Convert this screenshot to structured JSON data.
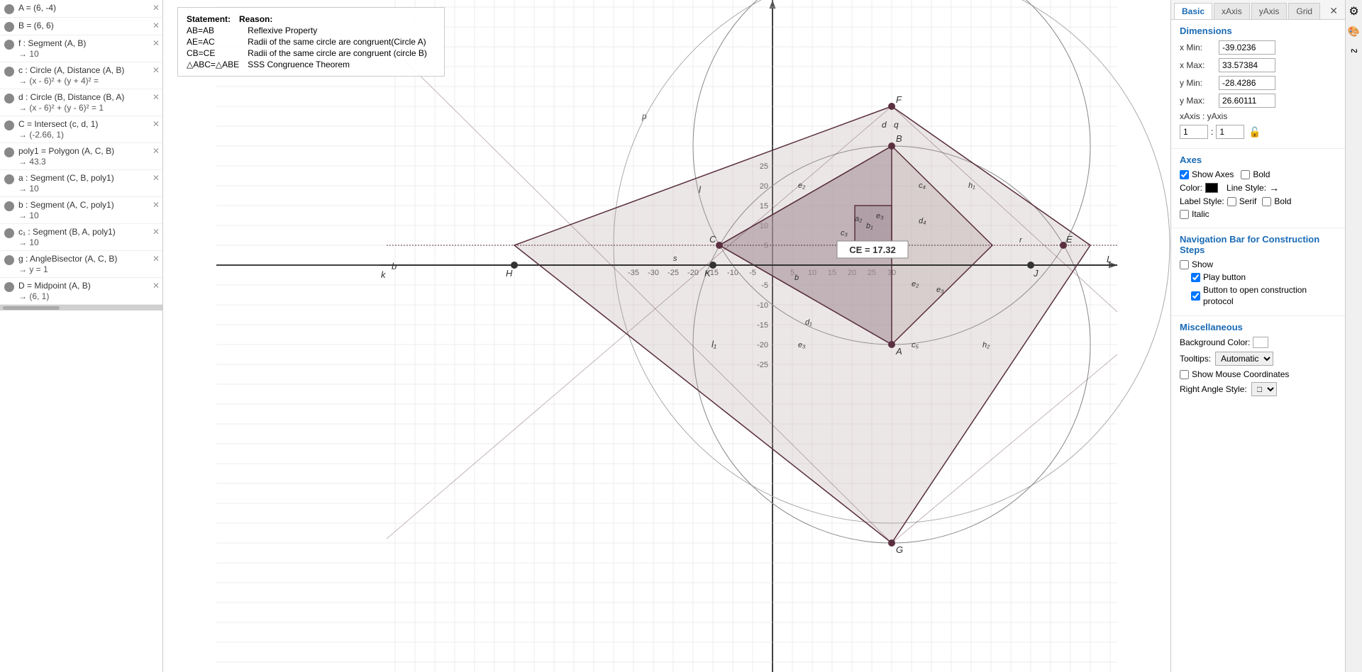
{
  "sidebar": {
    "items": [
      {
        "id": "A",
        "label": "A = (6, -4)",
        "value": null,
        "hasClose": true
      },
      {
        "id": "B",
        "label": "B = (6, 6)",
        "value": null,
        "hasClose": true
      },
      {
        "id": "f",
        "label": "f : Segment (A, B)",
        "value": "→ 10",
        "hasClose": true
      },
      {
        "id": "c",
        "label": "c : Circle (A, Distance (A, B)",
        "value": "→ (x - 6)² + (y + 4)² =",
        "hasClose": true
      },
      {
        "id": "d",
        "label": "d : Circle (B, Distance (B, A)",
        "value": "→ (x - 6)² + (y - 6)² = 1",
        "hasClose": true
      },
      {
        "id": "C",
        "label": "C = Intersect (c, d, 1)",
        "value": "→ (-2.66, 1)",
        "hasClose": true
      },
      {
        "id": "poly1",
        "label": "poly1 = Polygon (A, C, B)",
        "value": "→ 43.3",
        "hasClose": true
      },
      {
        "id": "a",
        "label": "a : Segment (C, B, poly1)",
        "value": "→ 10",
        "hasClose": true
      },
      {
        "id": "b_seg",
        "label": "b : Segment (A, C, poly1)",
        "value": "→ 10",
        "hasClose": true
      },
      {
        "id": "c1",
        "label": "c₁ : Segment (B, A, poly1)",
        "value": "→ 10",
        "hasClose": true
      },
      {
        "id": "g",
        "label": "g : AngleBisector (A, C, B)",
        "value": "→ y = 1",
        "hasClose": true
      },
      {
        "id": "D",
        "label": "D = Midpoint (A, B)",
        "value": "→ (6, 1)",
        "hasClose": true
      }
    ]
  },
  "proof": {
    "statement_header": "Statement:",
    "reason_header": "Reason:",
    "rows": [
      {
        "statement": "AB=AB",
        "reason": "Reflexive Property"
      },
      {
        "statement": "AE=AC",
        "reason": "Radii of the same circle are congruent(Circle A)"
      },
      {
        "statement": "CB=CE",
        "reason": "Radii of the same circle are congruent (circle B)"
      },
      {
        "statement": "△ABC=△ABE",
        "reason": "SSS Congruence Theorem"
      }
    ]
  },
  "canvas": {
    "ce_label": "CE = 17.32",
    "grid_labels": {
      "x_positive": [
        "5",
        "10",
        "15",
        "20",
        "25",
        "30"
      ],
      "x_negative": [
        "-5",
        "-10",
        "-15",
        "-20",
        "-25",
        "-30",
        "-35"
      ],
      "y_positive": [
        "5",
        "10",
        "15",
        "20",
        "25"
      ],
      "y_negative": [
        "-5",
        "-10",
        "-15",
        "-20",
        "-25"
      ]
    },
    "point_labels": [
      "A",
      "B",
      "C",
      "E",
      "F",
      "G",
      "H",
      "K",
      "L",
      "J",
      "p",
      "q",
      "r",
      "s",
      "b",
      "k",
      "d",
      "l",
      "l₁",
      "e₂",
      "e₃",
      "c₄",
      "h₁",
      "h₂",
      "d₁",
      "d₄",
      "a₂",
      "b₁",
      "c₃",
      "e₂",
      "e₃",
      "c₅"
    ]
  },
  "right_panel": {
    "tabs": [
      {
        "id": "basic",
        "label": "Basic",
        "active": true
      },
      {
        "id": "xaxis",
        "label": "xAxis"
      },
      {
        "id": "yaxis",
        "label": "yAxis"
      },
      {
        "id": "grid",
        "label": "Grid"
      }
    ],
    "dimensions": {
      "title": "Dimensions",
      "x_min_label": "x Min:",
      "x_min_value": "-39.0236",
      "x_max_label": "x Max:",
      "x_max_value": "33.57384",
      "y_min_label": "y Min:",
      "y_min_value": "-28.4286",
      "y_max_label": "y Max:",
      "y_max_value": "26.60111",
      "xaxis_label": "xAxis : yAxis",
      "ratio_x": "1",
      "ratio_y": "1"
    },
    "axes": {
      "title": "Axes",
      "show_axes_checked": true,
      "show_axes_label": "Show Axes",
      "bold_label": "Bold",
      "color_label": "Color:",
      "line_style_label": "Line Style:",
      "label_style_label": "Label Style:",
      "serif_label": "Serif",
      "bold2_label": "Bold",
      "italic_label": "Italic"
    },
    "navigation": {
      "title": "Navigation Bar for Construction Steps",
      "show_label": "Show",
      "play_button_label": "Play button",
      "open_protocol_label": "Button to open construction protocol"
    },
    "miscellaneous": {
      "title": "Miscellaneous",
      "bg_color_label": "Background Color:",
      "tooltips_label": "Tooltips:",
      "tooltips_value": "Automatic",
      "show_mouse_coords_label": "Show Mouse Coordinates",
      "right_angle_label": "Right Angle Style:"
    }
  }
}
